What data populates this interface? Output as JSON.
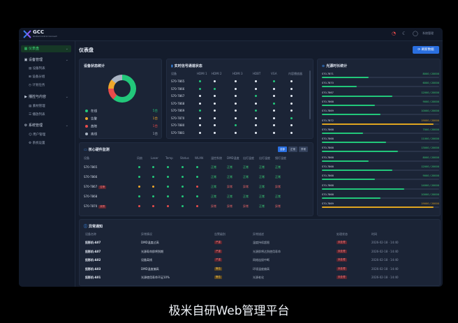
{
  "app": {
    "brand": "GCC",
    "brand_sub": "Global Control Connect",
    "user": "系统管理"
  },
  "sidebar": {
    "items": [
      {
        "label": "仪表盘",
        "icon": "grid-icon",
        "active": true
      },
      {
        "label": "设备管理",
        "icon": "device-icon",
        "active": false,
        "children": [
          "设备列表",
          "设备分组",
          "计划任务"
        ]
      },
      {
        "label": "播控与内容",
        "icon": "play-icon",
        "active": false,
        "children": [
          "素材管理",
          "播放列表"
        ]
      },
      {
        "label": "系统管理",
        "icon": "settings-icon",
        "active": false,
        "children": [
          "用户管理",
          "系统设置"
        ]
      }
    ]
  },
  "main": {
    "title": "仪表盘",
    "refresh_label": "刷新数据"
  },
  "device_status": {
    "title": "设备状态统计",
    "colors": {
      "online": "#22c77a",
      "warning": "#f0a72b",
      "fault": "#e94b4b",
      "offline": "#aab4c3"
    },
    "items": [
      {
        "label": "在线",
        "value": "5台",
        "share": 0.61,
        "color": "#22c77a"
      },
      {
        "label": "告警",
        "value": "1台",
        "share": 0.11,
        "color": "#f0a72b"
      },
      {
        "label": "故障",
        "value": "1台",
        "share": 0.14,
        "color": "#e94b4b"
      },
      {
        "label": "离线",
        "value": "1台",
        "share": 0.14,
        "color": "#aab4c3"
      }
    ]
  },
  "signal": {
    "title": "实时信号通道状态",
    "columns": [
      "设备",
      "HDMI 1",
      "HDMI 2",
      "HDMI 3",
      "HDBT",
      "VGA",
      "内容播放器"
    ],
    "rows": [
      {
        "name": "S70-7865",
        "dots": [
          "g",
          "w",
          "w",
          "w",
          "g",
          "w"
        ]
      },
      {
        "name": "S70-7866",
        "dots": [
          "g",
          "g",
          "w",
          "w",
          "w",
          "w"
        ]
      },
      {
        "name": "S70-7867",
        "dots": [
          "w",
          "w",
          "w",
          "g",
          "w",
          "w"
        ]
      },
      {
        "name": "S70-7868",
        "dots": [
          "w",
          "w",
          "w",
          "w",
          "g",
          "w"
        ]
      },
      {
        "name": "S70-7869",
        "dots": [
          "g",
          "w",
          "w",
          "g",
          "w",
          "w"
        ]
      },
      {
        "name": "S70-7870",
        "dots": [
          "w",
          "w",
          "w",
          "w",
          "w",
          "g"
        ]
      },
      {
        "name": "S70-7880",
        "dots": [
          "w",
          "w",
          "g",
          "w",
          "w",
          "w"
        ]
      },
      {
        "name": "S70-7881",
        "dots": [
          "w",
          "w",
          "w",
          "w",
          "w",
          "w"
        ]
      }
    ]
  },
  "runtime": {
    "title": "光源时长统计",
    "rows": [
      {
        "name": "S70-7871",
        "value": "8000 / 20000",
        "pct": 0.4,
        "color": "#22c77a"
      },
      {
        "name": "S70-7870",
        "value": "6000 / 20000",
        "pct": 0.3,
        "color": "#22c77a"
      },
      {
        "name": "S70-7867",
        "value": "12000 / 20000",
        "pct": 0.6,
        "color": "#22c77a"
      },
      {
        "name": "S70-7868",
        "value": "9000 / 20000",
        "pct": 0.45,
        "color": "#22c77a"
      },
      {
        "name": "S70-7869",
        "value": "10000 / 20000",
        "pct": 0.5,
        "color": "#22c77a"
      },
      {
        "name": "S70-7872",
        "value": "19000 / 20000",
        "pct": 0.95,
        "color": "#e0a520"
      },
      {
        "name": "S70-7868",
        "value": "7000 / 20000",
        "pct": 0.35,
        "color": "#22c77a"
      },
      {
        "name": "S70-7868",
        "value": "11000 / 20000",
        "pct": 0.55,
        "color": "#22c77a"
      },
      {
        "name": "S70-7868",
        "value": "13000 / 20000",
        "pct": 0.65,
        "color": "#22c77a"
      },
      {
        "name": "S70-7868",
        "value": "8000 / 20000",
        "pct": 0.4,
        "color": "#22c77a"
      },
      {
        "name": "S70-7868",
        "value": "12000 / 20000",
        "pct": 0.6,
        "color": "#22c77a"
      },
      {
        "name": "S70-7868",
        "value": "9000 / 20000",
        "pct": 0.45,
        "color": "#22c77a"
      },
      {
        "name": "S70-7868",
        "value": "14000 / 20000",
        "pct": 0.7,
        "color": "#22c77a"
      },
      {
        "name": "S70-7868",
        "value": "10000 / 20000",
        "pct": 0.5,
        "color": "#22c77a"
      },
      {
        "name": "S70-7869",
        "value": "19000 / 20000",
        "pct": 0.95,
        "color": "#e0a520"
      }
    ]
  },
  "hardware": {
    "title": "核心硬件监测",
    "filters": [
      "全部",
      "正常",
      "异常"
    ],
    "columns": [
      "设备",
      "风扇",
      "Laser",
      "Temp",
      "Status",
      "WLAN",
      "温控系统",
      "DMD温度",
      "出灯温度",
      "出灯温度",
      "镜灯温度"
    ],
    "rows": [
      {
        "name": "S70-7865",
        "badge": "",
        "dots": [
          "g",
          "g",
          "g",
          "g",
          "g"
        ],
        "texts": [
          "正常",
          "正常",
          "正常",
          "正常",
          "正常"
        ]
      },
      {
        "name": "S70-7866",
        "badge": "",
        "dots": [
          "g",
          "g",
          "g",
          "g",
          "g"
        ],
        "texts": [
          "正常",
          "正常",
          "正常",
          "正常",
          "正常"
        ]
      },
      {
        "name": "S70-7867",
        "badge": "告警",
        "dots": [
          "y",
          "y",
          "g",
          "g",
          "r"
        ],
        "texts": [
          "正常",
          "异常",
          "异常",
          "正常",
          "异常"
        ]
      },
      {
        "name": "S70-7868",
        "badge": "",
        "dots": [
          "g",
          "g",
          "g",
          "g",
          "g"
        ],
        "texts": [
          "正常",
          "正常",
          "正常",
          "正常",
          "正常"
        ]
      },
      {
        "name": "S70-7870",
        "badge": "故障",
        "dots": [
          "r",
          "r",
          "r",
          "g",
          "r"
        ],
        "texts": [
          "异常",
          "异常",
          "异常",
          "正常",
          "异常"
        ]
      }
    ]
  },
  "alerts": {
    "title": "异常通知",
    "columns": [
      "设备名称",
      "异常情况",
      "告警级别",
      "异常描述",
      "处理状态",
      "时间"
    ],
    "rows": [
      {
        "device": "投影机-A07",
        "issue": "DMD温度过高",
        "level": "严重",
        "desc": "温度持续超限",
        "status": "未处理",
        "time": "2026-02-18 · 14:40"
      },
      {
        "device": "投影机-A07",
        "issue": "光源寿命即将到期",
        "level": "严重",
        "desc": "光源即将达到使用寿命",
        "status": "未处理",
        "time": "2026-02-18 · 14:40"
      },
      {
        "device": "投影机-A02",
        "issue": "设备离线",
        "level": "严重",
        "desc": "网络连接中断",
        "status": "未处理",
        "time": "2026-02-18 · 14:40"
      },
      {
        "device": "投影机-A03",
        "issue": "DMD温度偏高",
        "level": "警告",
        "desc": "环境温度偏高",
        "status": "未处理",
        "time": "2026-02-18 · 14:40"
      },
      {
        "device": "投影机-A01",
        "issue": "光源使用寿命不足10%",
        "level": "警告",
        "desc": "光源老化",
        "status": "未处理",
        "time": "2026-02-18 · 14:40"
      }
    ]
  },
  "caption": "极米自研Web管理平台"
}
